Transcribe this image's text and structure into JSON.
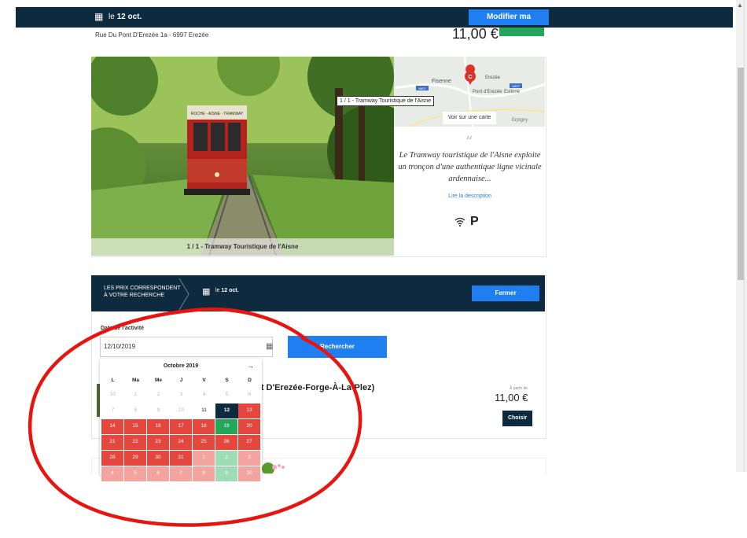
{
  "topbar": {
    "date_prefix": "le",
    "date": "12 oct.",
    "modify_label": "Modifier ma recherche"
  },
  "listing": {
    "address": "Rue Du Pont D'Erezée 1a - 6997 Erezée",
    "price_top": "11,00 €",
    "photo_caption": "1 / 1 - Tramway Touristique de l'Aisne",
    "tooltip": "1 / 1 - Tramway Touristique de l'Aisne",
    "map_link": "Voir sur une carte",
    "map_labels": [
      "Fisenne",
      "Erezée",
      "Pont d'Erezée",
      "Estinne",
      "Erpigny",
      "N807",
      "N807"
    ],
    "quote_mark": "“",
    "quote": "Le Tramway touristique de l'Aisne exploite un tronçon d'une authentique ligne vicinale ardennaise...",
    "read_more": "Lire la description",
    "parking_label": "P",
    "tram_sign": "ROCHE - AISNE - TRAMWAY"
  },
  "panel": {
    "header_text_1": "LES PRIX CORRESPONDENT",
    "header_text_2": "À VOTRE RECHERCHE",
    "date_prefix": "le",
    "date": "12 oct.",
    "close_label": "Fermer",
    "date_field_label": "Date de l'activité",
    "date_value": "12/10/2019",
    "search_label": "Rechercher"
  },
  "offer": {
    "title": "(pont D'Erezée-Forge-À-La-Plez)",
    "from_label": "À partir de",
    "price": "11,00 €",
    "choose_label": "Choisir"
  },
  "calendar": {
    "month": "Octobre 2019",
    "next": "→",
    "weekdays": [
      "L",
      "Ma",
      "Me",
      "J",
      "V",
      "S",
      "D"
    ],
    "days": [
      {
        "d": "30",
        "s": "off"
      },
      {
        "d": "1",
        "s": "off"
      },
      {
        "d": "2",
        "s": "off"
      },
      {
        "d": "3",
        "s": "off"
      },
      {
        "d": "4",
        "s": "off"
      },
      {
        "d": "5",
        "s": "off"
      },
      {
        "d": "6",
        "s": "off"
      },
      {
        "d": "7",
        "s": "off"
      },
      {
        "d": "8",
        "s": "off"
      },
      {
        "d": "9",
        "s": "off"
      },
      {
        "d": "10",
        "s": "off"
      },
      {
        "d": "11",
        "s": "normal"
      },
      {
        "d": "12",
        "s": "sel"
      },
      {
        "d": "13",
        "s": "red"
      },
      {
        "d": "14",
        "s": "red"
      },
      {
        "d": "15",
        "s": "red"
      },
      {
        "d": "16",
        "s": "red"
      },
      {
        "d": "17",
        "s": "red"
      },
      {
        "d": "18",
        "s": "red"
      },
      {
        "d": "19",
        "s": "green"
      },
      {
        "d": "20",
        "s": "red"
      },
      {
        "d": "21",
        "s": "red"
      },
      {
        "d": "22",
        "s": "red"
      },
      {
        "d": "23",
        "s": "red"
      },
      {
        "d": "24",
        "s": "red"
      },
      {
        "d": "25",
        "s": "red"
      },
      {
        "d": "26",
        "s": "red"
      },
      {
        "d": "27",
        "s": "red"
      },
      {
        "d": "28",
        "s": "red"
      },
      {
        "d": "29",
        "s": "red"
      },
      {
        "d": "30",
        "s": "red"
      },
      {
        "d": "31",
        "s": "red"
      },
      {
        "d": "1",
        "s": "lred"
      },
      {
        "d": "2",
        "s": "lgreen"
      },
      {
        "d": "3",
        "s": "lred"
      },
      {
        "d": "4",
        "s": "lred"
      },
      {
        "d": "5",
        "s": "lred"
      },
      {
        "d": "6",
        "s": "lred"
      },
      {
        "d": "7",
        "s": "lred"
      },
      {
        "d": "8",
        "s": "lred"
      },
      {
        "d": "9",
        "s": "lgreen"
      },
      {
        "d": "10",
        "s": "lred"
      }
    ]
  },
  "colors": {
    "navy": "#0e2a3e",
    "blue": "#1f7ef0",
    "green": "#22a65a",
    "red": "#e5473f",
    "annotation": "#e8140f"
  }
}
